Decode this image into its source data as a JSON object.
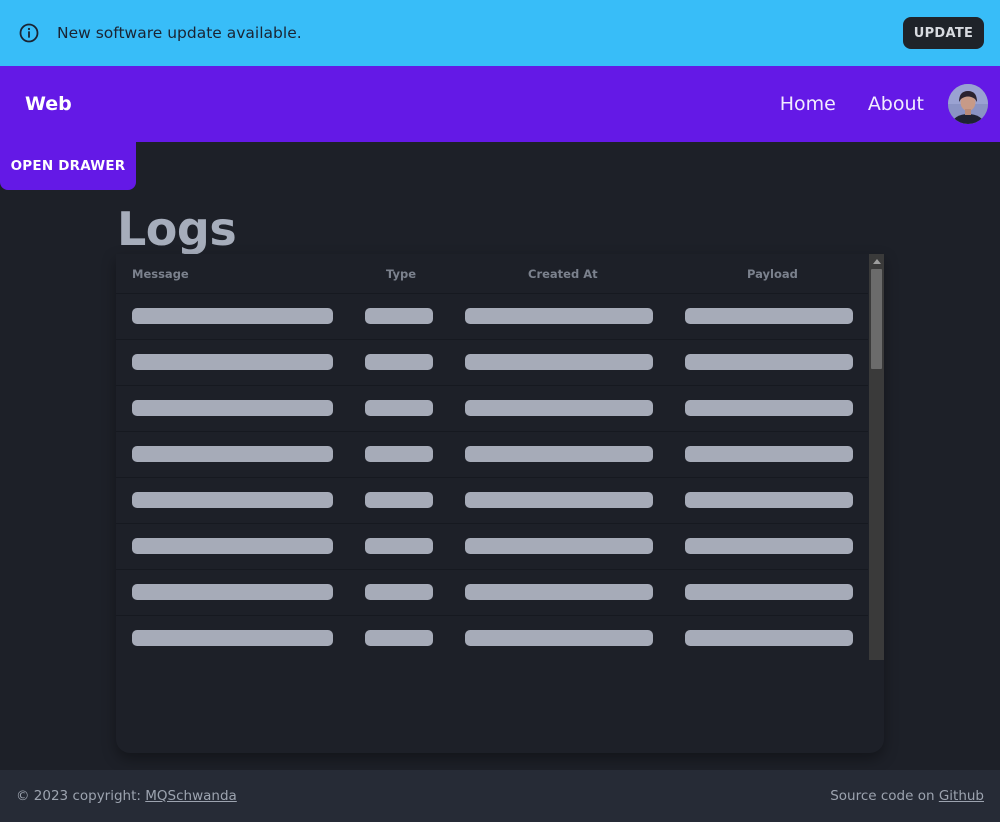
{
  "banner": {
    "message": "New software update available.",
    "update_label": "UPDATE",
    "icon": "info-icon"
  },
  "navbar": {
    "brand": "Web",
    "links": [
      "Home",
      "About"
    ],
    "avatar": "avatar"
  },
  "drawer": {
    "label": "OPEN DRAWER"
  },
  "page": {
    "title": "Logs"
  },
  "table": {
    "columns": [
      "Message",
      "Type",
      "Created At",
      "Payload"
    ],
    "rows_loading": 8
  },
  "footer": {
    "copyright_prefix": "© 2023 copyright: ",
    "copyright_link": "MQSchwanda",
    "source_prefix": "Source code on ",
    "source_link": "Github"
  },
  "colors": {
    "banner_bg": "#38bdf8",
    "navbar_bg": "#6419e6",
    "page_bg": "#1d2028",
    "footer_bg": "#262b36",
    "skeleton": "#a6abb8"
  }
}
